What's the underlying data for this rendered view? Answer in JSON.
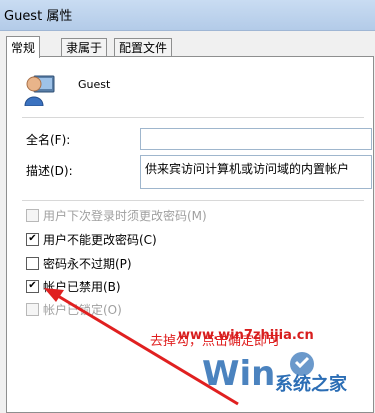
{
  "window": {
    "title": "Guest 属性"
  },
  "tabs": [
    {
      "label": "常规",
      "active": true
    },
    {
      "label": "隶属于",
      "active": false
    },
    {
      "label": "配置文件",
      "active": false
    }
  ],
  "user": {
    "name": "Guest",
    "icon": "user-icon"
  },
  "form": {
    "full_name_label": "全名(F):",
    "full_name_value": "",
    "description_label": "描述(D):",
    "description_value": "供来宾访问计算机或访问域的内置帐户"
  },
  "checkboxes": [
    {
      "label": "用户下次登录时须更改密码(M)",
      "checked": false,
      "enabled": false
    },
    {
      "label": "用户不能更改密码(C)",
      "checked": true,
      "enabled": true
    },
    {
      "label": "密码永不过期(P)",
      "checked": false,
      "enabled": true
    },
    {
      "label": "帐户已禁用(B)",
      "checked": true,
      "enabled": true
    },
    {
      "label": "帐户已锁定(O)",
      "checked": false,
      "enabled": false
    }
  ],
  "annotation": {
    "text": "去掉勾，点击确定即可"
  },
  "watermark": {
    "url": "www.win7zhijia.cn",
    "logo_text": "系统之家"
  },
  "colors": {
    "annotation": "#e02020",
    "titlebar": "#c9dcf2",
    "watermark_blue": "#2c6eb5"
  }
}
